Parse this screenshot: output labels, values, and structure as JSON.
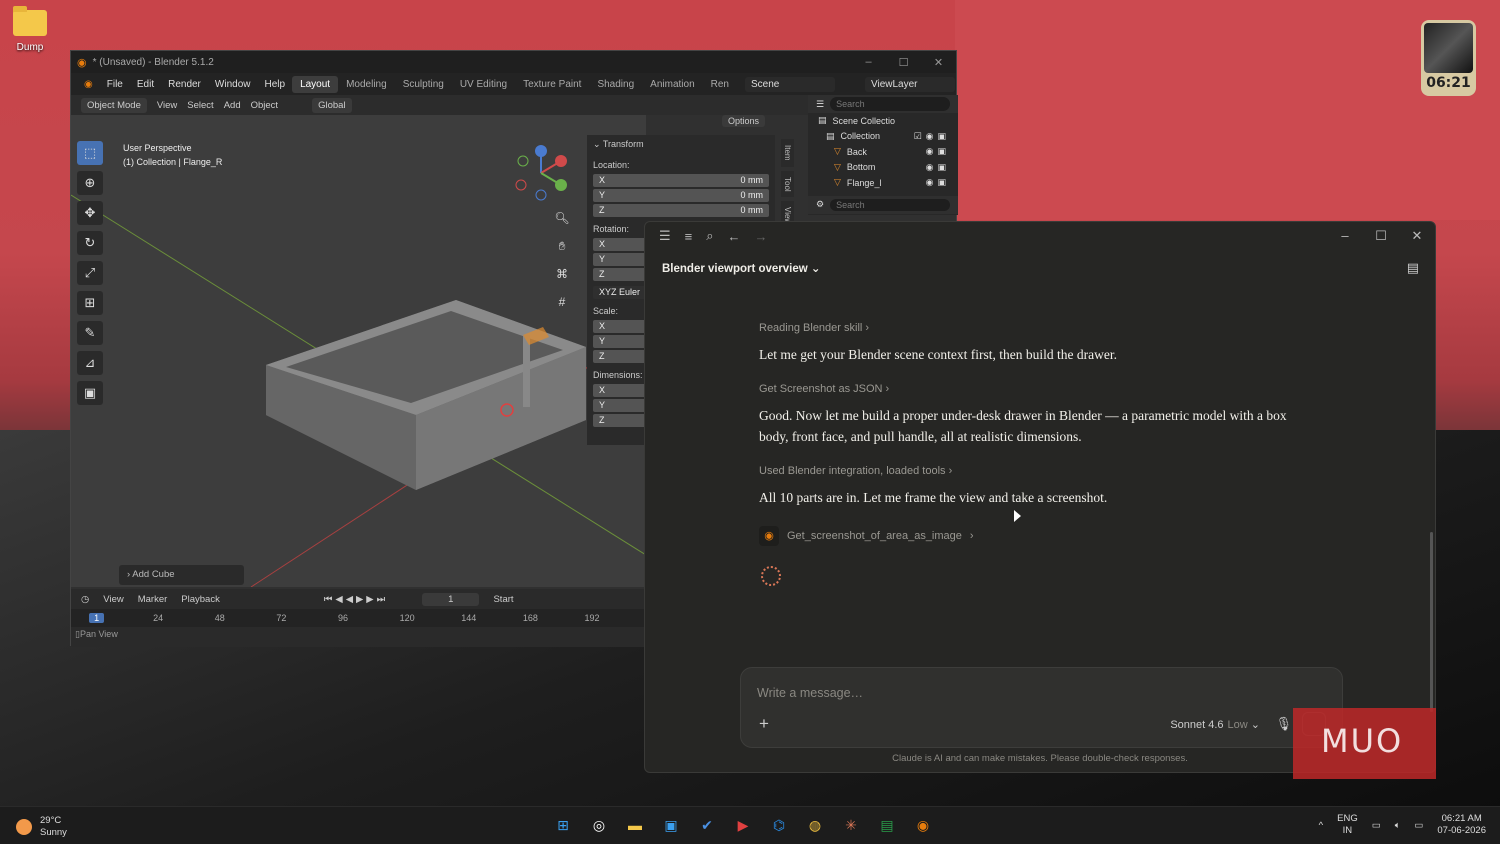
{
  "desktop": {
    "icon_label": "Dump",
    "clock_widget_time": "06:21"
  },
  "blender": {
    "title": "* (Unsaved) - Blender 5.1.2",
    "menu": [
      "File",
      "Edit",
      "Render",
      "Window",
      "Help"
    ],
    "workspaces": [
      "Layout",
      "Modeling",
      "Sculpting",
      "UV Editing",
      "Texture Paint",
      "Shading",
      "Animation",
      "Ren"
    ],
    "scene": "Scene",
    "view_layer": "ViewLayer",
    "header": {
      "mode": "Object Mode",
      "menus": [
        "View",
        "Select",
        "Add",
        "Object"
      ],
      "orientation": "Global",
      "options": "Options"
    },
    "viewport": {
      "perspective": "User Perspective",
      "collection_info": "(1) Collection | Flange_R",
      "last_op": "Add Cube"
    },
    "npanel": {
      "section": "Transform",
      "location_label": "Location:",
      "location": [
        {
          "axis": "X",
          "value": "0 mm"
        },
        {
          "axis": "Y",
          "value": "0 mm"
        },
        {
          "axis": "Z",
          "value": "0 mm"
        }
      ],
      "rotation_label": "Rotation:",
      "rotation_axes": [
        "X",
        "Y",
        "Z"
      ],
      "rotation_mode": "XYZ Euler",
      "scale_label": "Scale:",
      "scale_axes": [
        "X",
        "Y",
        "Z"
      ],
      "dimensions_label": "Dimensions:",
      "dimension_axes": [
        "X",
        "Y",
        "Z"
      ],
      "tabs": [
        "Item",
        "Tool",
        "View"
      ]
    },
    "outliner": {
      "search_placeholder": "Search",
      "items": [
        {
          "label": "Scene Collectio"
        },
        {
          "label": "Collection"
        },
        {
          "label": "Back"
        },
        {
          "label": "Bottom"
        },
        {
          "label": "Flange_l"
        }
      ]
    },
    "timeline": {
      "menus": [
        "View",
        "Marker",
        "Playback"
      ],
      "current_frame": "1",
      "start_label": "Start",
      "ticks": [
        "1",
        "24",
        "48",
        "72",
        "96",
        "120",
        "144",
        "168",
        "192"
      ],
      "status": "Pan View"
    }
  },
  "claude": {
    "conversation_title": "Blender viewport overview",
    "steps": [
      {
        "label": "Reading Blender skill",
        "message": "Let me get your Blender scene context first, then build the drawer."
      },
      {
        "label": "Get Screenshot as JSON",
        "message": "Good. Now let me build a proper under-desk drawer in Blender — a parametric model with a box body, front face, and pull handle, all at realistic dimensions."
      },
      {
        "label": "Used Blender integration, loaded tools",
        "message": "All 10 parts are in. Let me frame the view and take a screenshot."
      }
    ],
    "tool_call": "Get_screenshot_of_area_as_image",
    "composer_placeholder": "Write a message…",
    "model": "Sonnet 4.6",
    "effort": "Low",
    "disclaimer": "Claude is AI and can make mistakes. Please double-check responses."
  },
  "watermark": "MUO",
  "taskbar": {
    "weather_temp": "29°C",
    "weather_desc": "Sunny",
    "lang_line1": "ENG",
    "lang_line2": "IN",
    "time": "06:21 AM",
    "date": "07-06-2026"
  }
}
